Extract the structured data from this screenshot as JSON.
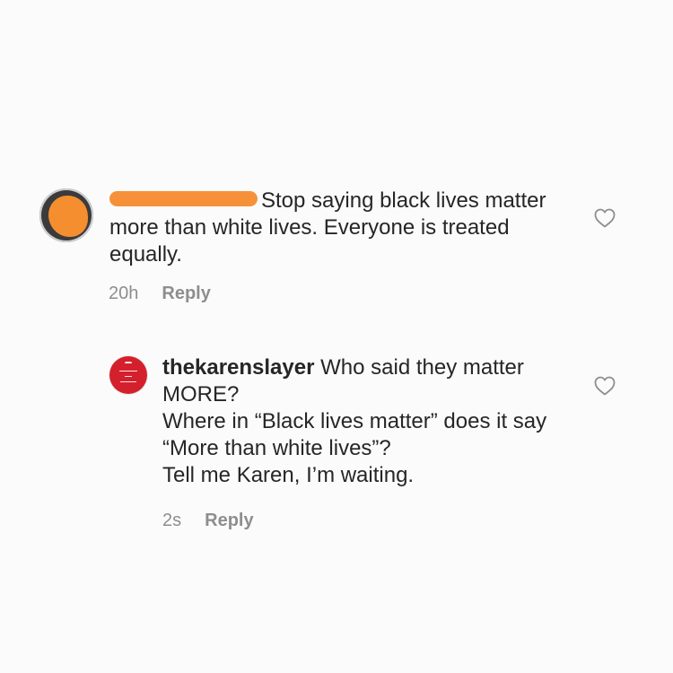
{
  "comments": [
    {
      "username": "",
      "text": "Stop saying black lives matter more than white lives. Everyone is treated equally.",
      "time": "20h",
      "reply_label": "Reply",
      "avatar_color": "#f58e2f",
      "redaction_color": "#f6913a"
    },
    {
      "username": "thekarenslayer",
      "text": "Who said they matter MORE?\nWhere in “Black lives matter” does it say “More than white lives”?\nTell me Karen, I’m waiting.",
      "time": "2s",
      "reply_label": "Reply",
      "avatar_color": "#d4202c"
    }
  ],
  "icons": {
    "like": "heart-outline-icon"
  },
  "colors": {
    "background": "#fbfbfb",
    "text": "#262626",
    "meta": "#8e8e8e"
  }
}
